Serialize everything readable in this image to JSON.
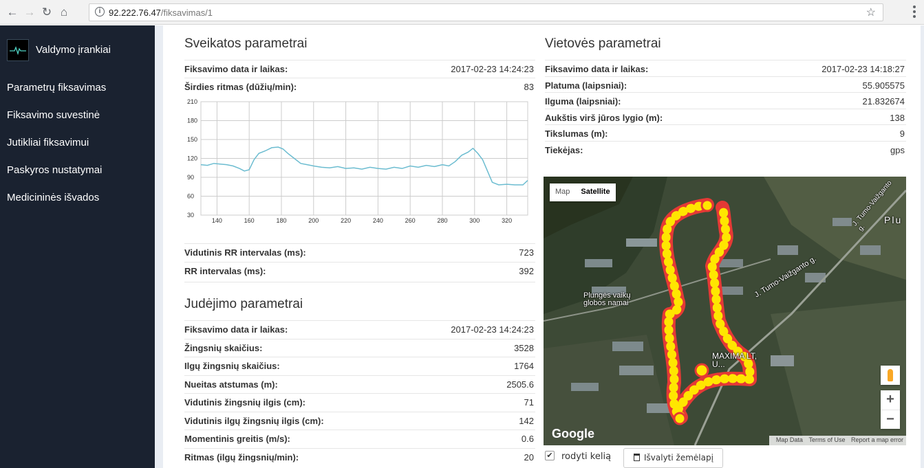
{
  "browser": {
    "url_host": "92.222.76.47",
    "url_path": "/fiksavimas/1"
  },
  "sidebar": {
    "brand": "Valdymo įrankiai",
    "items": [
      {
        "label": "Parametrų fiksavimas"
      },
      {
        "label": "Fiksavimo suvestinė"
      },
      {
        "label": "Jutikliai fiksavimui"
      },
      {
        "label": "Paskyros nustatymai"
      },
      {
        "label": "Medicininės išvados"
      }
    ]
  },
  "health": {
    "title": "Sveikatos parametrai",
    "rows": [
      {
        "label": "Fiksavimo data ir laikas:",
        "value": "2017-02-23 14:24:23"
      },
      {
        "label": "Širdies ritmas (dūžių/min):",
        "value": "83"
      }
    ],
    "rows_after": [
      {
        "label": "Vidutinis RR intervalas (ms):",
        "value": "723"
      },
      {
        "label": "RR intervalas (ms):",
        "value": "392"
      }
    ]
  },
  "chart_data": {
    "type": "line",
    "title": "",
    "xlabel": "",
    "ylabel": "",
    "xlim": [
      130,
      333
    ],
    "ylim": [
      30,
      210
    ],
    "x_ticks": [
      140,
      160,
      180,
      200,
      220,
      240,
      260,
      280,
      300,
      320
    ],
    "y_ticks": [
      30,
      60,
      90,
      120,
      150,
      180,
      210
    ],
    "grid": true,
    "color": "#6bbcd0",
    "series": [
      {
        "x": [
          130,
          134,
          138,
          142,
          146,
          150,
          154,
          157,
          160,
          163,
          166,
          170,
          174,
          178,
          181,
          184,
          188,
          192,
          196,
          200,
          205,
          210,
          215,
          220,
          225,
          230,
          235,
          240,
          245,
          250,
          255,
          260,
          265,
          270,
          275,
          280,
          284,
          288,
          292,
          296,
          299,
          302,
          305,
          308,
          311,
          315,
          320,
          325,
          330,
          333
        ],
        "y": [
          110,
          109,
          112,
          111,
          110,
          108,
          104,
          100,
          102,
          118,
          128,
          132,
          137,
          138,
          135,
          128,
          120,
          112,
          110,
          108,
          106,
          105,
          107,
          104,
          105,
          103,
          106,
          104,
          103,
          106,
          104,
          108,
          106,
          109,
          107,
          110,
          108,
          115,
          125,
          130,
          136,
          128,
          118,
          100,
          82,
          78,
          79,
          78,
          78,
          85
        ]
      }
    ]
  },
  "movement": {
    "title": "Judėjimo parametrai",
    "rows": [
      {
        "label": "Fiksavimo data ir laikas:",
        "value": "2017-02-23 14:24:23"
      },
      {
        "label": "Žingsnių skaičius:",
        "value": "3528"
      },
      {
        "label": "Ilgų žingsnių skaičius:",
        "value": "1764"
      },
      {
        "label": "Nueitas atstumas (m):",
        "value": "2505.6"
      },
      {
        "label": "Vidutinis žingsnių ilgis (cm):",
        "value": "71"
      },
      {
        "label": "Vidutinis ilgų žingsnių ilgis (cm):",
        "value": "142"
      },
      {
        "label": "Momentinis greitis (m/s):",
        "value": "0.6"
      },
      {
        "label": "Ritmas (ilgų žingsnių/min):",
        "value": "20"
      }
    ]
  },
  "location": {
    "title": "Vietovės parametrai",
    "rows": [
      {
        "label": "Fiksavimo data ir laikas:",
        "value": "2017-02-23 14:18:27"
      },
      {
        "label": "Platuma (laipsniai):",
        "value": "55.905575"
      },
      {
        "label": "Ilguma (laipsniai):",
        "value": "21.832674"
      },
      {
        "label": "Aukštis virš jūros lygio (m):",
        "value": "138"
      },
      {
        "label": "Tikslumas (m):",
        "value": "9"
      },
      {
        "label": "Tiekėjas:",
        "value": "gps"
      }
    ]
  },
  "map": {
    "type_map": "Map",
    "type_satellite": "Satellite",
    "label_place": "Plungės vaikų globos namai",
    "label_street1": "J. Tumo-Vaižganto g.",
    "label_street2": "J. Tumo-Vaižganto g.",
    "label_city": "Plu",
    "label_shop": "MAXIMA LT, U...",
    "google": "Google",
    "attrib_data": "Map Data",
    "attrib_terms": "Terms of Use",
    "attrib_report": "Report a map error",
    "route_color": "#ffe600",
    "route_border": "#e53935"
  },
  "controls": {
    "show_path": "rodyti kelią",
    "clear_map": "Išvalyti žemėlapį"
  }
}
